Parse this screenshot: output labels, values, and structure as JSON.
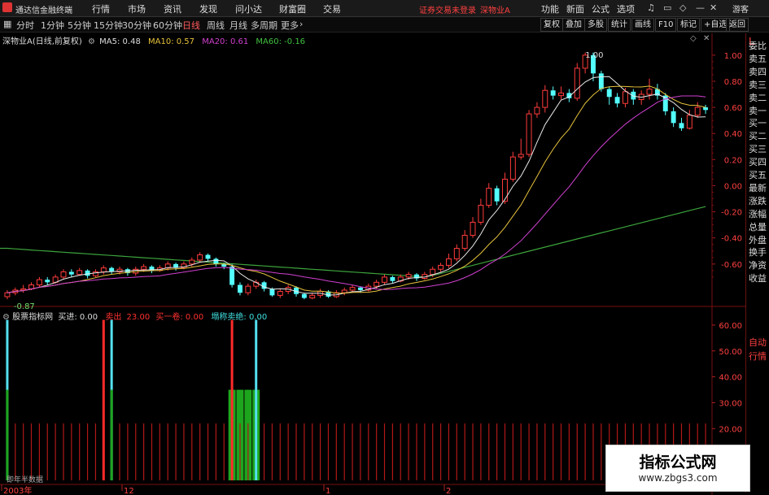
{
  "titlebar": {
    "app_name": "通达信金融终端",
    "menus": [
      "行情",
      "市场",
      "资讯",
      "发现",
      "问小达",
      "财富圈",
      "交易"
    ],
    "warning": "证券交易未登录",
    "stock_tag": "深物业A",
    "right_menus": [
      "功能",
      "新面",
      "公式",
      "选项"
    ],
    "user": "游客"
  },
  "toolbar": {
    "periods": [
      "分时",
      "1分钟",
      "5分钟",
      "15分钟",
      "30分钟",
      "60分钟",
      "日线",
      "周线",
      "月线",
      "多周期",
      "更多"
    ],
    "active_period": "日线",
    "buttons": [
      "复权",
      "叠加",
      "多股",
      "统计",
      "画线",
      "F10",
      "标记",
      "+自选",
      "返回"
    ]
  },
  "main_info": {
    "title": "深物业A(日线,前复权)",
    "ma5": "MA5: 0.48",
    "ma10": "MA10: 0.57",
    "ma20": "MA20: 0.61",
    "ma60": "MA60: -0.16"
  },
  "price_axis": [
    "1.00",
    "0.80",
    "0.60",
    "0.40",
    "0.20",
    "0.00",
    "-0.20",
    "-0.40",
    "-0.60"
  ],
  "annotations": {
    "high": "1.00",
    "low": "-0.87"
  },
  "sub_info": {
    "title": "股票指标网",
    "buy": "买进: 0.00",
    "sell": "卖出",
    "sell_val": "23.00",
    "buy1": "买一卷: 0.00",
    "weak": "塌称卖绝: 0.00"
  },
  "sub_axis": [
    "60.00",
    "50.00",
    "40.00",
    "30.00",
    "20.00"
  ],
  "time_axis": [
    "2003年",
    "12",
    "1",
    "2"
  ],
  "bottom_note": "即年半数据",
  "side_panel": [
    "委比",
    "卖五",
    "卖四",
    "卖三",
    "卖二",
    "卖一",
    "买一",
    "买二",
    "买三",
    "买四",
    "买五",
    "最新",
    "涨跌",
    "涨幅",
    "总量",
    "外盘",
    "换手",
    "净资",
    "收益"
  ],
  "side_bottom": [
    "自动",
    "行情"
  ],
  "watermark": {
    "title": "指标公式网",
    "url": "www.zbgs3.com"
  },
  "chart_data": {
    "type": "candlestick",
    "y_range": [
      -0.9,
      1.08
    ],
    "sub_y_range": [
      0,
      65
    ],
    "candles": [
      [
        -0.85,
        -0.82,
        -0.8,
        -0.87
      ],
      [
        -0.82,
        -0.8,
        -0.78,
        -0.84
      ],
      [
        -0.8,
        -0.79,
        -0.76,
        -0.82
      ],
      [
        -0.79,
        -0.76,
        -0.74,
        -0.8
      ],
      [
        -0.76,
        -0.72,
        -0.7,
        -0.78
      ],
      [
        -0.72,
        -0.74,
        -0.7,
        -0.76
      ],
      [
        -0.74,
        -0.7,
        -0.68,
        -0.75
      ],
      [
        -0.7,
        -0.66,
        -0.64,
        -0.72
      ],
      [
        -0.66,
        -0.68,
        -0.64,
        -0.7
      ],
      [
        -0.68,
        -0.65,
        -0.63,
        -0.69
      ],
      [
        -0.65,
        -0.69,
        -0.64,
        -0.71
      ],
      [
        -0.69,
        -0.66,
        -0.64,
        -0.7
      ],
      [
        -0.66,
        -0.63,
        -0.61,
        -0.68
      ],
      [
        -0.63,
        -0.66,
        -0.62,
        -0.68
      ],
      [
        -0.66,
        -0.64,
        -0.62,
        -0.68
      ],
      [
        -0.64,
        -0.67,
        -0.63,
        -0.69
      ],
      [
        -0.67,
        -0.64,
        -0.62,
        -0.69
      ],
      [
        -0.64,
        -0.62,
        -0.6,
        -0.66
      ],
      [
        -0.62,
        -0.65,
        -0.61,
        -0.67
      ],
      [
        -0.65,
        -0.63,
        -0.61,
        -0.66
      ],
      [
        -0.63,
        -0.6,
        -0.58,
        -0.65
      ],
      [
        -0.6,
        -0.63,
        -0.59,
        -0.65
      ],
      [
        -0.63,
        -0.6,
        -0.58,
        -0.64
      ],
      [
        -0.6,
        -0.57,
        -0.55,
        -0.62
      ],
      [
        -0.57,
        -0.53,
        -0.51,
        -0.59
      ],
      [
        -0.53,
        -0.56,
        -0.52,
        -0.58
      ],
      [
        -0.56,
        -0.6,
        -0.55,
        -0.62
      ],
      [
        -0.6,
        -0.62,
        -0.59,
        -0.64
      ],
      [
        -0.62,
        -0.76,
        -0.6,
        -0.78
      ],
      [
        -0.76,
        -0.82,
        -0.74,
        -0.84
      ],
      [
        -0.82,
        -0.77,
        -0.75,
        -0.84
      ],
      [
        -0.77,
        -0.74,
        -0.72,
        -0.79
      ],
      [
        -0.74,
        -0.79,
        -0.73,
        -0.81
      ],
      [
        -0.79,
        -0.84,
        -0.78,
        -0.85
      ],
      [
        -0.84,
        -0.81,
        -0.79,
        -0.86
      ],
      [
        -0.81,
        -0.78,
        -0.76,
        -0.83
      ],
      [
        -0.78,
        -0.83,
        -0.77,
        -0.85
      ],
      [
        -0.83,
        -0.86,
        -0.82,
        -0.87
      ],
      [
        -0.86,
        -0.84,
        -0.82,
        -0.87
      ],
      [
        -0.84,
        -0.81,
        -0.79,
        -0.86
      ],
      [
        -0.81,
        -0.85,
        -0.8,
        -0.86
      ],
      [
        -0.85,
        -0.82,
        -0.8,
        -0.86
      ],
      [
        -0.82,
        -0.8,
        -0.78,
        -0.84
      ],
      [
        -0.8,
        -0.78,
        -0.76,
        -0.82
      ],
      [
        -0.78,
        -0.8,
        -0.77,
        -0.82
      ],
      [
        -0.8,
        -0.77,
        -0.75,
        -0.81
      ],
      [
        -0.77,
        -0.74,
        -0.72,
        -0.79
      ],
      [
        -0.74,
        -0.7,
        -0.68,
        -0.76
      ],
      [
        -0.7,
        -0.73,
        -0.69,
        -0.75
      ],
      [
        -0.73,
        -0.7,
        -0.68,
        -0.74
      ],
      [
        -0.7,
        -0.68,
        -0.66,
        -0.72
      ],
      [
        -0.68,
        -0.71,
        -0.67,
        -0.73
      ],
      [
        -0.71,
        -0.68,
        -0.66,
        -0.72
      ],
      [
        -0.68,
        -0.64,
        -0.62,
        -0.7
      ],
      [
        -0.64,
        -0.61,
        -0.59,
        -0.66
      ],
      [
        -0.61,
        -0.56,
        -0.52,
        -0.63
      ],
      [
        -0.56,
        -0.48,
        -0.45,
        -0.58
      ],
      [
        -0.48,
        -0.38,
        -0.34,
        -0.5
      ],
      [
        -0.38,
        -0.28,
        -0.24,
        -0.4
      ],
      [
        -0.28,
        -0.15,
        -0.1,
        -0.3
      ],
      [
        -0.15,
        -0.02,
        0.02,
        -0.17
      ],
      [
        -0.02,
        -0.12,
        0.0,
        -0.15
      ],
      [
        -0.12,
        0.05,
        0.1,
        -0.14
      ],
      [
        0.05,
        0.22,
        0.26,
        0.03
      ],
      [
        0.22,
        0.24,
        0.36,
        0.2
      ],
      [
        0.24,
        0.55,
        0.58,
        0.22
      ],
      [
        0.55,
        0.6,
        0.64,
        0.52
      ],
      [
        0.6,
        0.73,
        0.77,
        0.56
      ],
      [
        0.73,
        0.69,
        0.76,
        0.66
      ],
      [
        0.69,
        0.71,
        0.76,
        0.66
      ],
      [
        0.71,
        0.67,
        0.74,
        0.64
      ],
      [
        0.67,
        0.9,
        0.94,
        0.65
      ],
      [
        0.9,
        1.0,
        1.02,
        0.86
      ],
      [
        1.0,
        0.86,
        1.02,
        0.8
      ],
      [
        0.86,
        0.74,
        0.88,
        0.72
      ],
      [
        0.74,
        0.68,
        0.76,
        0.62
      ],
      [
        0.68,
        0.63,
        0.71,
        0.6
      ],
      [
        0.63,
        0.72,
        0.75,
        0.6
      ],
      [
        0.72,
        0.66,
        0.74,
        0.62
      ],
      [
        0.66,
        0.7,
        0.73,
        0.62
      ],
      [
        0.7,
        0.74,
        0.82,
        0.66
      ],
      [
        0.74,
        0.69,
        0.78,
        0.66
      ],
      [
        0.69,
        0.57,
        0.71,
        0.54
      ],
      [
        0.57,
        0.48,
        0.6,
        0.45
      ],
      [
        0.48,
        0.44,
        0.52,
        0.42
      ],
      [
        0.44,
        0.54,
        0.58,
        0.43
      ],
      [
        0.54,
        0.6,
        0.64,
        0.52
      ],
      [
        0.6,
        0.58,
        0.62,
        0.55
      ]
    ],
    "ma60_start": -0.48,
    "ma60_end": -0.16,
    "sub_bars": {
      "spikes_cyan": [
        0,
        13,
        31
      ],
      "spikes_red": [
        12,
        28
      ],
      "green_block": [
        28,
        29,
        30,
        31
      ]
    }
  }
}
